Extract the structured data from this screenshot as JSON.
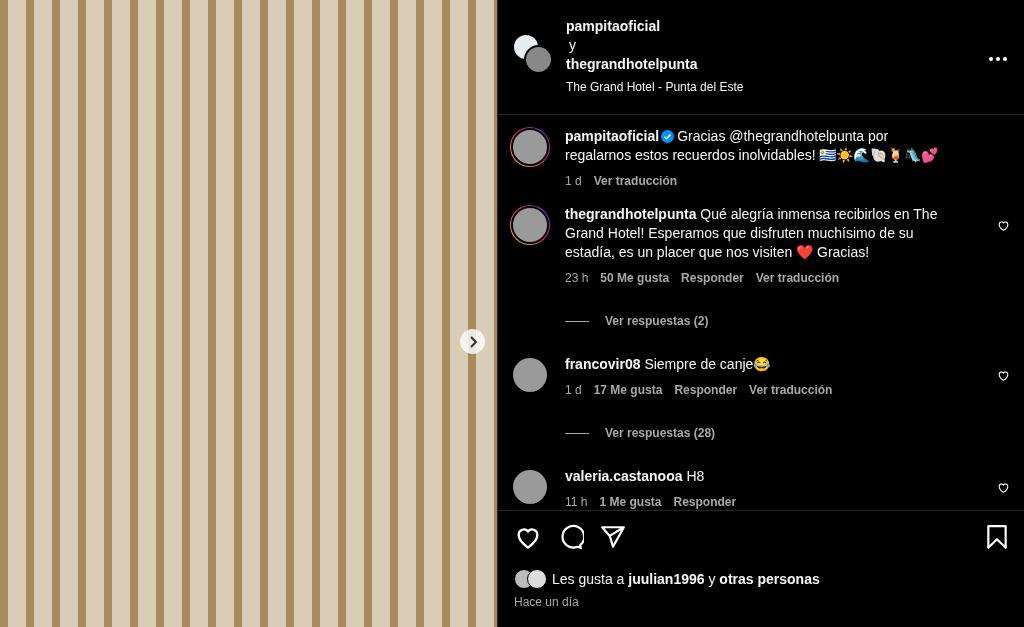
{
  "header": {
    "owner": "pampitaoficial",
    "conjunction": "y",
    "collaborator": "thegrandhotelpunta",
    "location": "The Grand Hotel - Punta del Este"
  },
  "comments": [
    {
      "kind": "caption",
      "username": "pampitaoficial",
      "verified": true,
      "text": "Gracias @thegrandhotelpunta por regalarnos estos recuerdos inolvidables! 🇺🇾☀️🌊🐚🍹🛝💕",
      "time": "1 d",
      "actions": [
        "Ver traducción"
      ]
    },
    {
      "kind": "comment",
      "username": "thegrandhotelpunta",
      "verified": false,
      "text": "Qué alegría inmensa recibirlos en The Grand Hotel! Esperamos que disfruten muchísimo de su estadía, es un placer que nos visiten ❤️ Gracias!",
      "time": "23 h",
      "likes": "50 Me gusta",
      "actions": [
        "Responder",
        "Ver traducción"
      ],
      "replies": "Ver respuestas (2)"
    },
    {
      "kind": "comment",
      "username": "francovir08",
      "verified": false,
      "text": "Siempre de canje😂",
      "time": "1 d",
      "likes": "17 Me gusta",
      "actions": [
        "Responder",
        "Ver traducción"
      ],
      "replies": "Ver respuestas (28)"
    },
    {
      "kind": "comment",
      "username": "valeria.castanooa",
      "verified": false,
      "text": "H8",
      "time": "11 h",
      "likes": "1 Me gusta",
      "actions": [
        "Responder"
      ]
    }
  ],
  "liked_by": "Les gusta a **juulian1996** y **otras personas**",
  "posted": "Hace un día"
}
